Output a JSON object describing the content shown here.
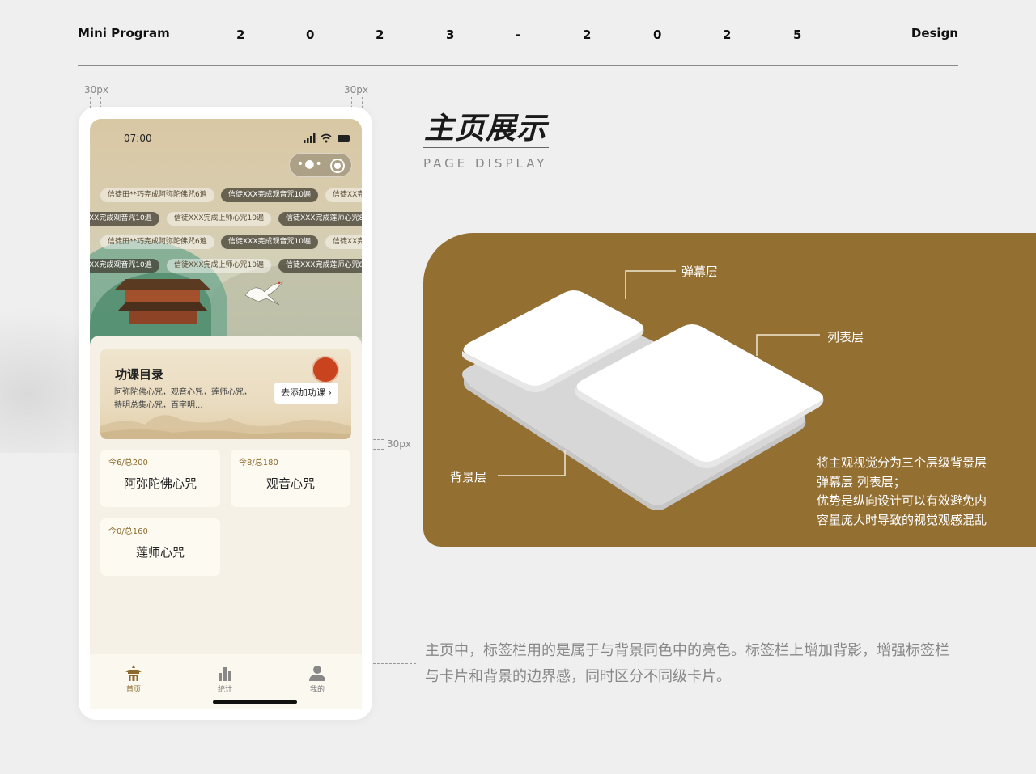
{
  "header": {
    "left": "Mini Program",
    "year_chars": [
      "2",
      "0",
      "2",
      "3",
      "-",
      "2",
      "0",
      "2",
      "5"
    ],
    "right": "Design"
  },
  "guides": {
    "left_margin": "30px",
    "right_margin": "30px",
    "card_gap": "30px"
  },
  "phone": {
    "status_time": "07:00",
    "danmu_rows": [
      [
        "信徒田**巧完成阿弥陀佛咒6遍",
        "信徒XXX完成观音咒10遍",
        "信徒XX完"
      ],
      [
        "XX完成观音咒10遍",
        "信徒XXX完成上师心咒10遍",
        "信徒XXX完成莲师心咒8"
      ],
      [
        "信徒田**巧完成阿弥陀佛咒6遍",
        "信徒XXX完成观音咒10遍",
        "信徒XX完"
      ],
      [
        "XX完成观音咒10遍",
        "信徒XXX完成上师心咒10遍",
        "信徒XXX完成莲师心咒8"
      ]
    ],
    "catalog": {
      "title": "功课目录",
      "desc_line1": "阿弥陀佛心咒，观音心咒，莲师心咒，",
      "desc_line2": "持明总集心咒，百字明...",
      "add_button": "去添加功课"
    },
    "cards": [
      {
        "count": "今6/总200",
        "name": "阿弥陀佛心咒"
      },
      {
        "count": "今8/总180",
        "name": "观音心咒"
      },
      {
        "count": "今0/总160",
        "name": "莲师心咒"
      }
    ],
    "tabs": [
      {
        "label": "首页",
        "icon": "pavilion-icon"
      },
      {
        "label": "统计",
        "icon": "bar-chart-icon"
      },
      {
        "label": "我的",
        "icon": "user-icon"
      }
    ]
  },
  "section": {
    "title_cn": "主页展示",
    "title_en": "PAGE DISPLAY"
  },
  "layers": {
    "danmu_layer": "弹幕层",
    "list_layer": "列表层",
    "background_layer": "背景层",
    "desc": [
      "将主观视觉分为三个层级背景层",
      "弹幕层 列表层；",
      "优势是纵向设计可以有效避免内",
      "容量庞大时导致的视觉观感混乱"
    ]
  },
  "footer": {
    "desc": "主页中，标签栏用的是属于与背景同色中的亮色。标签栏上增加背影，增强标签栏与卡片和背景的边界感，同时区分不同级卡片。"
  },
  "colors": {
    "accent_brown": "#946f32",
    "gold_text": "#8c6a2b",
    "seal_red": "#c9431f",
    "page_bg": "#efefef"
  }
}
